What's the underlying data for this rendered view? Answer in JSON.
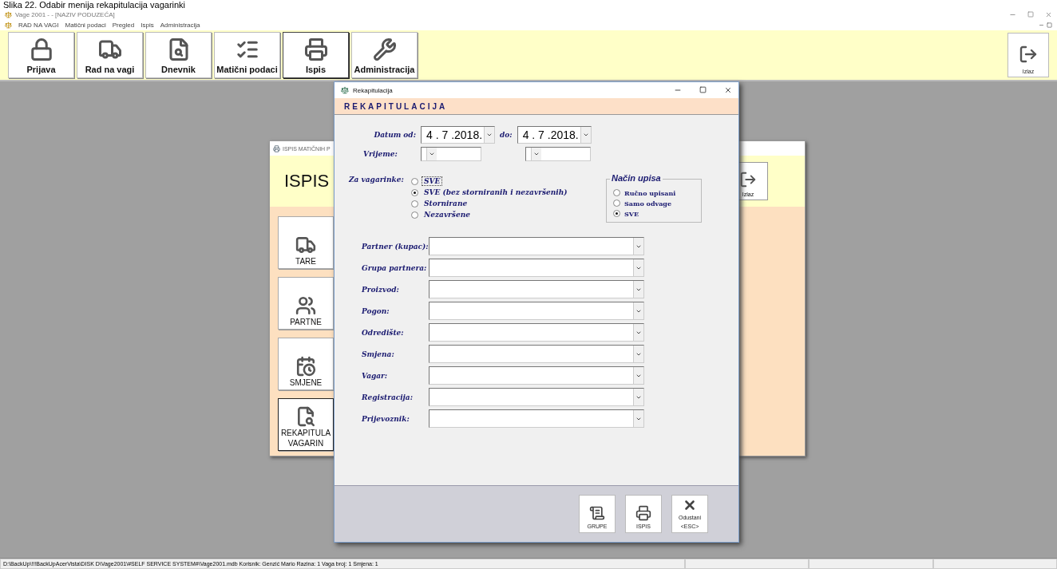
{
  "caption": "Slika 22. Odabir menija rekapitulacija vagarinki",
  "window": {
    "title": "Vage 2001 - - [NAZIV PODUZEĆA]"
  },
  "menu": [
    "RAD NA VAGI",
    "Matični podaci",
    "Pregled",
    "Ispis",
    "Administracija"
  ],
  "toolbar": [
    {
      "label": "Prijava",
      "selected": false
    },
    {
      "label": "Rad na vagi",
      "selected": false
    },
    {
      "label": "Dnevnik",
      "selected": false
    },
    {
      "label": "Matični podaci",
      "selected": false
    },
    {
      "label": "Ispis",
      "selected": true
    },
    {
      "label": "Administracija",
      "selected": false
    }
  ],
  "exit_button": {
    "label": "Izlaz"
  },
  "background_window": {
    "title": "ISPIS MATIČNIH P",
    "heading": "ISPIS",
    "exit_label": "Izlaz",
    "buttons": [
      {
        "lines": [
          "TARE"
        ],
        "selected": false
      },
      {
        "lines": [
          "PARTNE"
        ],
        "selected": false
      },
      {
        "lines": [
          "SMJENE"
        ],
        "selected": false
      },
      {
        "lines": [
          "REKAPITULA",
          "VAGARIN"
        ],
        "selected": true
      }
    ]
  },
  "dialog": {
    "title": "Rekapitulacija",
    "header": "REKAPITULACIJA",
    "date_from": {
      "label": "Datum  od:",
      "value": "4 . 7 .2018."
    },
    "date_to": {
      "label": "do:",
      "value": "4 . 7 .2018."
    },
    "time": {
      "label": "Vrijeme:"
    },
    "za_vagarinke": {
      "label": "Za vagarinke:",
      "options": [
        {
          "label": "SVE",
          "selected": false,
          "focused": true
        },
        {
          "label": "SVE (bez storniranih i nezavršenih)",
          "selected": true,
          "focused": false
        },
        {
          "label": "Stornirane",
          "selected": false,
          "focused": false
        },
        {
          "label": "Nezavršene",
          "selected": false,
          "focused": false
        }
      ]
    },
    "nacin_upisa": {
      "title": "Način upisa",
      "options": [
        {
          "label": "Ručno upisani",
          "selected": false
        },
        {
          "label": "Samo odvage",
          "selected": false
        },
        {
          "label": "SVE",
          "selected": true
        }
      ]
    },
    "filters": [
      "Partner (kupac):",
      "Grupa partnera:",
      "Proizvod:",
      "Pogon:",
      "Odredište:",
      "Smjena:",
      "Vagar:",
      "Registracija:",
      "Prijevoznik:"
    ],
    "buttons": [
      {
        "label": "GRUPE"
      },
      {
        "label": "ISPIS"
      },
      {
        "label": "Odustani",
        "sublabel": "<ESC>"
      }
    ]
  },
  "status_bar": {
    "text": "D:\\BackUp\\!!!BackUpAcerVista\\DISK D\\Vage2001\\#SELF SERVICE SYSTEM#\\Vage2001.mdb  Korisnik: Genzić Mario   Razina: 1   Vaga broj: 1    Smjena: 1"
  }
}
